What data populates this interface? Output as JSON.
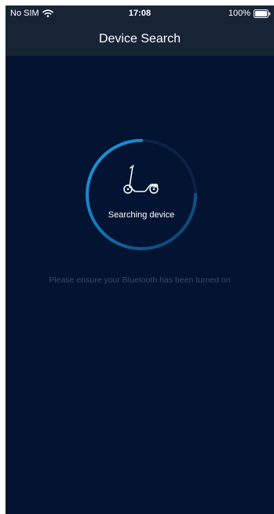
{
  "status_bar": {
    "carrier": "No SIM",
    "time": "17:08",
    "battery": "100%",
    "wifi_icon": "wifi-icon",
    "battery_icon": "battery-icon"
  },
  "nav": {
    "title": "Device Search"
  },
  "search": {
    "label": "Searching device",
    "device_icon": "scooter-icon",
    "hint": "Please ensure your Bluetooth has been turned on"
  },
  "colors": {
    "background": "#021431",
    "header": "#172436",
    "ring_accent": "#1e8fd8",
    "hint_text": "#3b4a63"
  }
}
